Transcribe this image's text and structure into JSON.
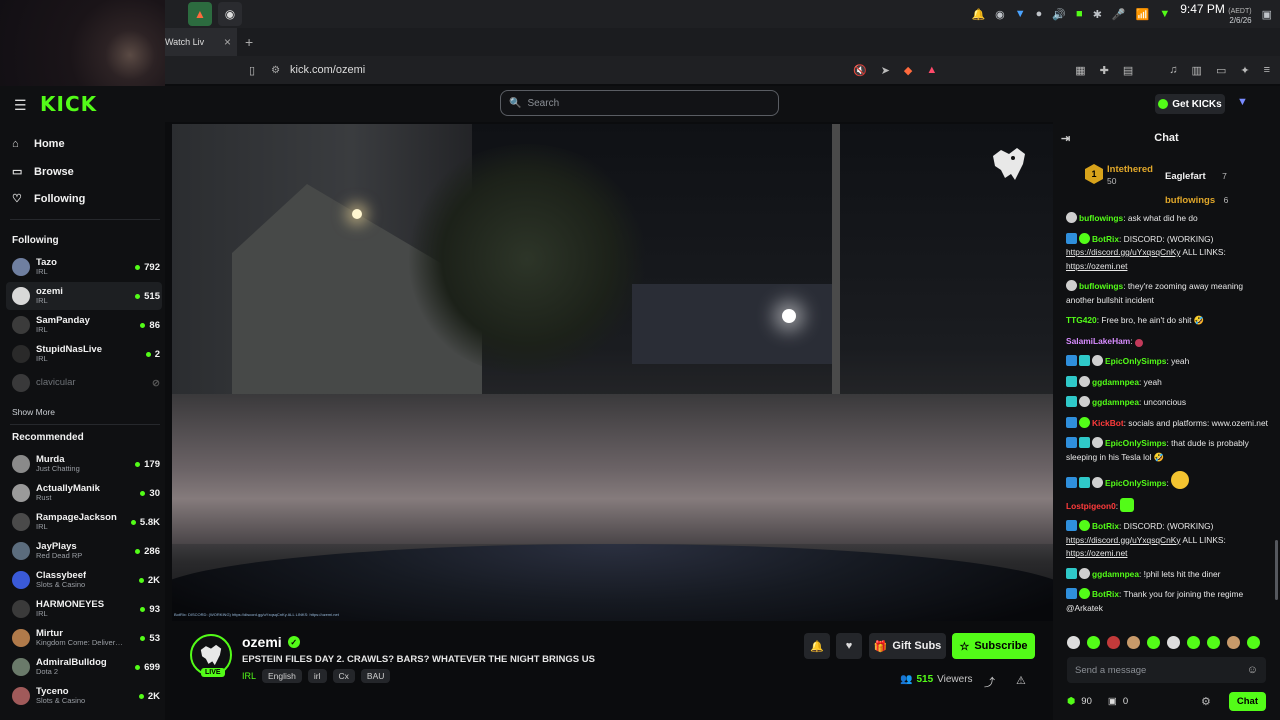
{
  "os": {
    "time": "9:47 PM",
    "tz": "(AEDT)",
    "date": "2/6/26"
  },
  "browser": {
    "tab_title": "Watch Liv",
    "url": "kick.com/ozemi",
    "colors": {
      "accent": "#53fc18"
    }
  },
  "header": {
    "logo": "KICK",
    "search_placeholder": "Search",
    "get_kicks": "Get KICKs"
  },
  "sidebar": {
    "nav": [
      {
        "label": "Home",
        "icon": "home-icon"
      },
      {
        "label": "Browse",
        "icon": "browse-icon"
      },
      {
        "label": "Following",
        "icon": "heart-icon"
      }
    ],
    "following_title": "Following",
    "following": [
      {
        "name": "Tazo",
        "category": "IRL",
        "viewers": "792"
      },
      {
        "name": "ozemi",
        "category": "IRL",
        "viewers": "515"
      },
      {
        "name": "SamPanday",
        "category": "IRL",
        "viewers": "86"
      },
      {
        "name": "StupidNasLive",
        "category": "IRL",
        "viewers": "2"
      },
      {
        "name": "clavicular",
        "category": "",
        "viewers": ""
      }
    ],
    "show_more": "Show More",
    "recommended_title": "Recommended",
    "recommended": [
      {
        "name": "Murda",
        "category": "Just Chatting",
        "viewers": "179"
      },
      {
        "name": "ActuallyManik",
        "category": "Rust",
        "viewers": "30"
      },
      {
        "name": "RampageJackson",
        "category": "IRL",
        "viewers": "5.8K"
      },
      {
        "name": "JayPlays",
        "category": "Red Dead RP",
        "viewers": "286"
      },
      {
        "name": "Classybeef",
        "category": "Slots & Casino",
        "viewers": "2K"
      },
      {
        "name": "HARMONEYES",
        "category": "IRL",
        "viewers": "93"
      },
      {
        "name": "Mirtur",
        "category": "Kingdom Come: Deliver…",
        "viewers": "53"
      },
      {
        "name": "AdmiralBulldog",
        "category": "Dota 2",
        "viewers": "699"
      },
      {
        "name": "Tyceno",
        "category": "Slots & Casino",
        "viewers": "2K"
      }
    ]
  },
  "stream": {
    "channel": "ozemi",
    "live": "LIVE",
    "title": "EPSTEIN FILES DAY 2. CRAWLS? BARS? WHATEVER THE NIGHT BRINGS US",
    "category": "IRL",
    "tags": [
      "English",
      "irl",
      "Cx",
      "BAU"
    ],
    "gift_subs": "Gift Subs",
    "subscribe": "Subscribe",
    "viewers": "515",
    "viewers_label": "Viewers",
    "overlay_text": "BotRix: DISCORD: (WORKING) https://discord.gg/uYxqsqCnKy ALL LINKS: https://ozemi.net"
  },
  "chat": {
    "title": "Chat",
    "leaderboard": [
      {
        "rank": "1",
        "name": "Intethered",
        "count": "50"
      },
      {
        "name": "Eaglefart",
        "count": "7"
      },
      {
        "name": "buflowings",
        "count": "6"
      }
    ],
    "messages": [
      {
        "user": "buflowings",
        "color": "#53fc18",
        "text": ": ask what did he do"
      },
      {
        "user": "BotRix",
        "color": "#53fc18",
        "text": ": DISCORD: (WORKING) ",
        "link1": "https://discord.gg/uYxqsqCnKy",
        "mid": " ALL LINKS: ",
        "link2": "https://ozemi.net"
      },
      {
        "user": "buflowings",
        "color": "#53fc18",
        "text": ": they're zooming away meaning another bullshit incident"
      },
      {
        "user": "TTG420",
        "color": "#53fc18",
        "text": ": Free bro, he ain't do shit 🤣"
      },
      {
        "user": "SalamiLakeHam",
        "color": "#d88cff",
        "text": ": "
      },
      {
        "user": "EpicOnlySimps",
        "color": "#53fc18",
        "text": ": yeah"
      },
      {
        "user": "ggdamnpea",
        "color": "#53fc18",
        "text": ": yeah"
      },
      {
        "user": "ggdamnpea",
        "color": "#53fc18",
        "text": ": unconcious"
      },
      {
        "user": "KickBot",
        "color": "#ff3b3b",
        "text": ": socials and platforms: www.ozemi.net"
      },
      {
        "user": "EpicOnlySimps",
        "color": "#53fc18",
        "text": ": that dude is probably sleeping in his Tesla lol 🤣"
      },
      {
        "user": "EpicOnlySimps",
        "color": "#53fc18",
        "text": ": "
      },
      {
        "user": "Lostpigeon0",
        "color": "#ff3b3b",
        "text": ": "
      },
      {
        "user": "BotRix",
        "color": "#53fc18",
        "text": ": DISCORD: (WORKING) ",
        "link1": "https://discord.gg/uYxqsqCnKy",
        "mid": " ALL LINKS: ",
        "link2": "https://ozemi.net"
      },
      {
        "user": "ggdamnpea",
        "color": "#53fc18",
        "text": ": !phil lets hit the diner"
      },
      {
        "user": "BotRix",
        "color": "#53fc18",
        "text": ": Thank you for joining the regime @Arkatek"
      }
    ],
    "input_placeholder": "Send a message",
    "points": "90",
    "gifts": "0",
    "chat_button": "Chat"
  }
}
